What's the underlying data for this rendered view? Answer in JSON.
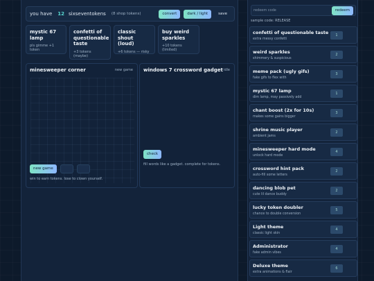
{
  "tokenbar": {
    "prefix": "you have",
    "count": "12",
    "unit": "sixseventokens",
    "shop_note": "(8 shop tokens)",
    "convert_label": "convert",
    "theme_label": "dark / light",
    "save_label": "save"
  },
  "shop_cards": [
    {
      "title": "mystic 67 lamp",
      "sub": "pls gimme +1 token"
    },
    {
      "title": "confetti of questionable taste",
      "sub": "+3 tokens (maybe)"
    },
    {
      "title": "classic shout (loud)",
      "sub": "+6 tokens — risky"
    },
    {
      "title": "buy weird sparkles",
      "sub": "+10 tokens (limited)"
    }
  ],
  "minesweeper": {
    "title": "minesweeper corner",
    "tag": "new game",
    "new_game_label": "new game",
    "note": "win to earn tokens. lose to clown yourself."
  },
  "crossword": {
    "title": "windows 7 crossword gadget",
    "tag": "idle",
    "check_label": "check",
    "note": "fill words like a gadget. complete for tokens."
  },
  "redeem": {
    "placeholder": "redeem code",
    "button_label": "redeem",
    "sample": "sample code: RELEASE"
  },
  "store_items": [
    {
      "name": "confetti of questionable taste",
      "desc": "extra messy confetti",
      "price": "1"
    },
    {
      "name": "weird sparkles",
      "desc": "shimmery & suspicious",
      "price": "2"
    },
    {
      "name": "meme pack (ugly gifs)",
      "desc": "fake gifs to flex with",
      "price": "3"
    },
    {
      "name": "mystic 67 lamp",
      "desc": "dim lamp, may passively add",
      "price": "1"
    },
    {
      "name": "chant boost (2x for 10s)",
      "desc": "makes some gains bigger",
      "price": "3"
    },
    {
      "name": "shrine music player",
      "desc": "ambient jams",
      "price": "2"
    },
    {
      "name": "minesweeper hard mode",
      "desc": "unlock hard mode",
      "price": "4"
    },
    {
      "name": "crossword hint pack",
      "desc": "auto-fill some letters",
      "price": "2"
    },
    {
      "name": "dancing blob pet",
      "desc": "cute lil dance buddy",
      "price": "2"
    },
    {
      "name": "lucky token doubler",
      "desc": "chance to double conversion",
      "price": "5"
    },
    {
      "name": "Light theme",
      "desc": "classic light skin",
      "price": "4"
    },
    {
      "name": "Administrator",
      "desc": "fake admin vibes",
      "price": "4"
    },
    {
      "name": "Deluxe theme",
      "desc": "extra animations & flair",
      "price": "6"
    }
  ]
}
